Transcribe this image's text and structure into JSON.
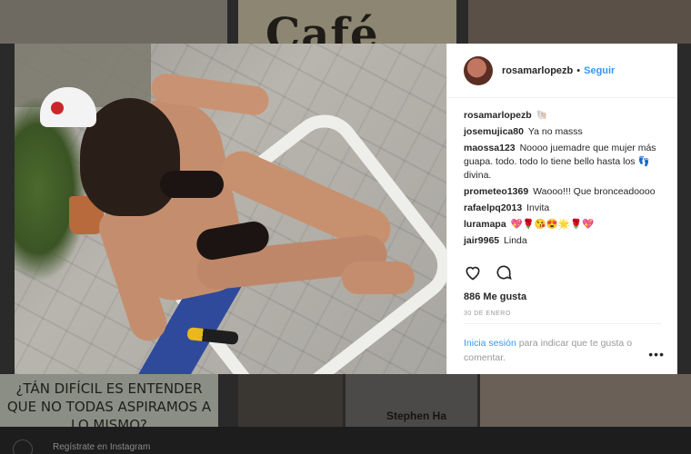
{
  "background": {
    "top_center_text": "Café",
    "bottom_left_quote": "¿TÁN DIFÍCIL ES ENTENDER QUE NO TODAS ASPIRAMOS A LO MISMO?",
    "bottom_name": "Stephen Ha",
    "footer_text": "Regístrate en Instagram"
  },
  "post": {
    "username": "rosamarlopezb",
    "separator": "•",
    "follow_label": "Seguir",
    "caption_emoji": "🐚",
    "comments": [
      {
        "user": "josemujica80",
        "text": "Ya no masss"
      },
      {
        "user": "maossa123",
        "text": "Noooo juemadre que mujer más guapa. todo. todo lo tiene bello hasta los 👣 divina."
      },
      {
        "user": "prometeo1369",
        "text": "Waooo!!! Que bronceadoooo"
      },
      {
        "user": "rafaelpq2013",
        "text": "Invita"
      },
      {
        "user": "luramapa",
        "text": "💖🌹😘😍🌟🌹💖"
      },
      {
        "user": "jair9965",
        "text": "Linda"
      }
    ],
    "like_icon": "heart-icon",
    "comment_icon": "comment-bubble-icon",
    "likes_text": "886 Me gusta",
    "date_text": "30 DE ENERO",
    "login_link": "Inicia sesión",
    "login_rest": " para indicar que te gusta o comentar.",
    "more_icon": "•••"
  },
  "colors": {
    "link_blue": "#3897f0",
    "text_dark": "#262626",
    "muted": "#999999"
  }
}
